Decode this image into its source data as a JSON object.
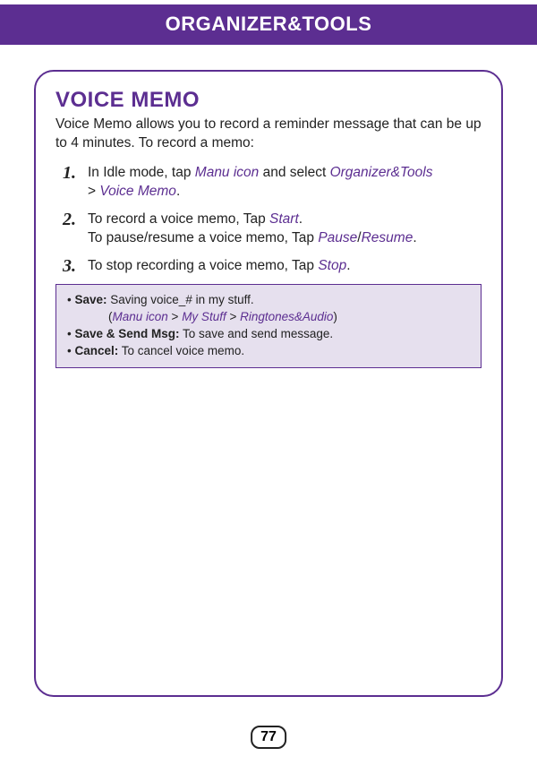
{
  "header": {
    "title": "ORGANIZER&TOOLS"
  },
  "section": {
    "title": "VOICE MEMO",
    "intro": "Voice Memo allows you to record a reminder message that can be up to 4 minutes. To record a memo:"
  },
  "steps": {
    "s1": {
      "num": "1.",
      "t1": "In Idle mode, tap ",
      "manu": "Manu icon",
      "t2": " and select ",
      "org": "Organizer&Tools",
      "gt": " > ",
      "vm": "Voice Memo",
      "t3": "."
    },
    "s2": {
      "num": "2.",
      "l1a": "To record a voice memo, Tap ",
      "start": "Start",
      "l1b": ".",
      "l2a": "To pause/resume a voice memo, Tap ",
      "pause": "Pause",
      "slash": "/",
      "resume": "Resume",
      "l2b": "."
    },
    "s3": {
      "num": "3.",
      "t1": "To stop recording a voice memo, Tap ",
      "stop": "Stop",
      "t2": "."
    }
  },
  "infobox": {
    "bullet": "• ",
    "save_label": "Save:",
    "save_text": " Saving voice_# in my stuff.",
    "path_open": "(",
    "manu": "Manu icon",
    "gt1": " > ",
    "mystuff": "My Stuff",
    "gt2": " > ",
    "ringtones": "Ringtones&Audio",
    "path_close": ")",
    "sendmsg_label": "Save & Send Msg:",
    "sendmsg_text": " To save and send message.",
    "cancel_label": "Cancel:",
    "cancel_text": " To cancel voice memo."
  },
  "page": "77"
}
